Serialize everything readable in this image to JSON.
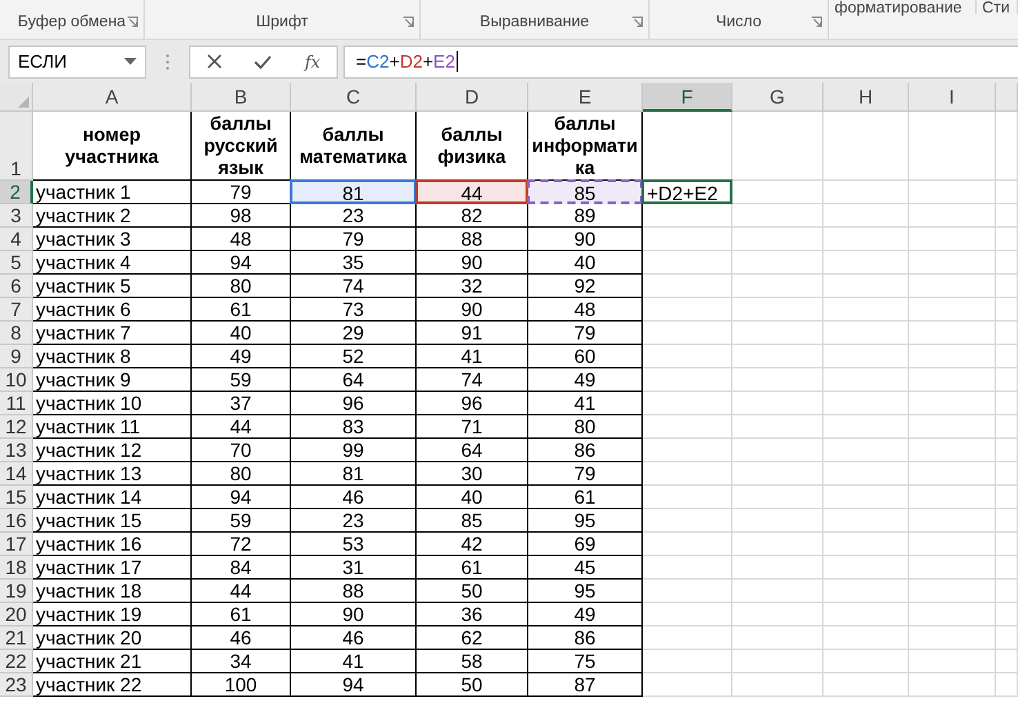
{
  "ribbon": {
    "groups": [
      {
        "label": "Буфер обмена",
        "launcher": true
      },
      {
        "label": "Шрифт",
        "launcher": true
      },
      {
        "label": "Выравнивание",
        "launcher": true
      },
      {
        "label": "Число",
        "launcher": true
      },
      {
        "label": "форматирование",
        "launcher": false
      },
      {
        "label": "Сти",
        "launcher": false
      }
    ]
  },
  "formula_bar": {
    "name_box": "ЕСЛИ",
    "function_button": "fx",
    "formula": [
      {
        "text": "=",
        "color": "#000000"
      },
      {
        "text": "C2",
        "color": "#2f6fd0"
      },
      {
        "text": "+",
        "color": "#000000"
      },
      {
        "text": "D2",
        "color": "#c8322f"
      },
      {
        "text": "+",
        "color": "#000000"
      },
      {
        "text": "E2",
        "color": "#8a4fc4"
      }
    ]
  },
  "columns": [
    {
      "label": "A",
      "selected": false
    },
    {
      "label": "B",
      "selected": false
    },
    {
      "label": "C",
      "selected": false
    },
    {
      "label": "D",
      "selected": false
    },
    {
      "label": "E",
      "selected": false
    },
    {
      "label": "F",
      "selected": true
    },
    {
      "label": "G",
      "selected": false
    },
    {
      "label": "H",
      "selected": false
    },
    {
      "label": "I",
      "selected": false
    }
  ],
  "header_row": {
    "number": "1",
    "cells": [
      "номер участника",
      "баллы русский язык",
      "баллы математика",
      "баллы физика",
      "баллы информати ка"
    ]
  },
  "rows": [
    {
      "number": "2",
      "selected": true,
      "cells": [
        {
          "text": "участник 1"
        },
        {
          "text": "79"
        },
        {
          "text": "81",
          "color": "#3c78d8"
        },
        {
          "text": "44",
          "color": "#c0392b"
        },
        {
          "text": "85",
          "color": "#8e5fc9"
        }
      ],
      "editing_text": "+D2+E2"
    },
    {
      "number": "3",
      "selected": false,
      "cells": [
        "участник 2",
        "98",
        "23",
        "82",
        "89"
      ]
    },
    {
      "number": "4",
      "selected": false,
      "cells": [
        "участник 3",
        "48",
        "79",
        "88",
        "90"
      ]
    },
    {
      "number": "5",
      "selected": false,
      "cells": [
        "участник 4",
        "94",
        "35",
        "90",
        "40"
      ]
    },
    {
      "number": "6",
      "selected": false,
      "cells": [
        "участник 5",
        "80",
        "74",
        "32",
        "92"
      ]
    },
    {
      "number": "7",
      "selected": false,
      "cells": [
        "участник 6",
        "61",
        "73",
        "90",
        "48"
      ]
    },
    {
      "number": "8",
      "selected": false,
      "cells": [
        "участник 7",
        "40",
        "29",
        "91",
        "79"
      ]
    },
    {
      "number": "9",
      "selected": false,
      "cells": [
        "участник 8",
        "49",
        "52",
        "41",
        "60"
      ]
    },
    {
      "number": "10",
      "selected": false,
      "cells": [
        "участник 9",
        "59",
        "64",
        "74",
        "49"
      ]
    },
    {
      "number": "11",
      "selected": false,
      "cells": [
        "участник 10",
        "37",
        "96",
        "96",
        "41"
      ]
    },
    {
      "number": "12",
      "selected": false,
      "cells": [
        "участник 11",
        "44",
        "83",
        "71",
        "80"
      ]
    },
    {
      "number": "13",
      "selected": false,
      "cells": [
        "участник 12",
        "70",
        "99",
        "64",
        "86"
      ]
    },
    {
      "number": "14",
      "selected": false,
      "cells": [
        "участник 13",
        "80",
        "81",
        "30",
        "79"
      ]
    },
    {
      "number": "15",
      "selected": false,
      "cells": [
        "участник 14",
        "94",
        "46",
        "40",
        "61"
      ]
    },
    {
      "number": "16",
      "selected": false,
      "cells": [
        "участник 15",
        "59",
        "23",
        "85",
        "95"
      ]
    },
    {
      "number": "17",
      "selected": false,
      "cells": [
        "участник 16",
        "72",
        "53",
        "42",
        "69"
      ]
    },
    {
      "number": "18",
      "selected": false,
      "cells": [
        "участник 17",
        "84",
        "31",
        "61",
        "45"
      ]
    },
    {
      "number": "19",
      "selected": false,
      "cells": [
        "участник 18",
        "44",
        "88",
        "50",
        "95"
      ]
    },
    {
      "number": "20",
      "selected": false,
      "cells": [
        "участник 19",
        "61",
        "90",
        "36",
        "49"
      ]
    },
    {
      "number": "21",
      "selected": false,
      "cells": [
        "участник 20",
        "46",
        "46",
        "62",
        "86"
      ]
    },
    {
      "number": "22",
      "selected": false,
      "cells": [
        "участник 21",
        "34",
        "41",
        "58",
        "75"
      ]
    },
    {
      "number": "23",
      "selected": false,
      "cells": [
        "участник 22",
        "100",
        "94",
        "50",
        "87"
      ]
    }
  ]
}
